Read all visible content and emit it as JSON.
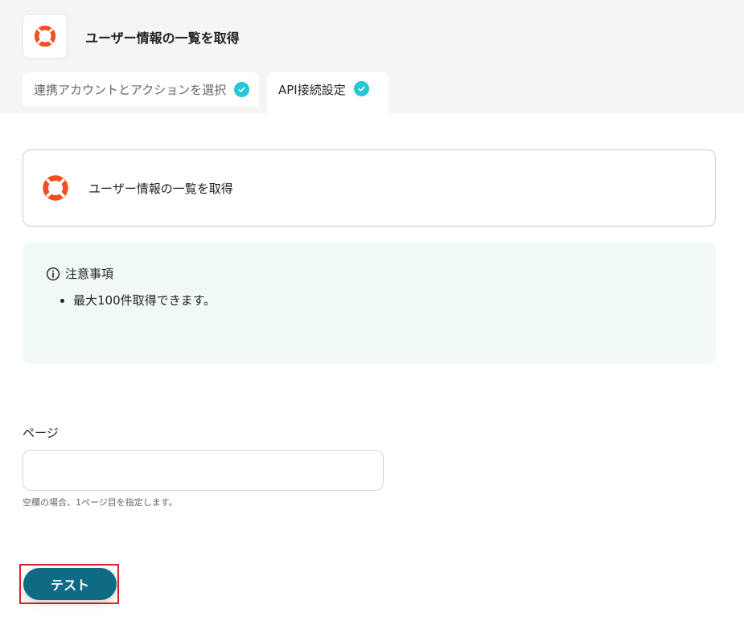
{
  "header": {
    "app_icon": "lifebuoy-icon",
    "title": "ユーザー情報の一覧を取得"
  },
  "tabs": [
    {
      "label": "連携アカウントとアクションを選択",
      "status_icon": "check-circle-icon",
      "completed": true,
      "active": false
    },
    {
      "label": "API接続設定",
      "status_icon": "check-circle-icon",
      "completed": true,
      "active": true
    }
  ],
  "action_card": {
    "icon": "lifebuoy-icon",
    "title": "ユーザー情報の一覧を取得"
  },
  "notice": {
    "icon": "info-icon",
    "heading": "注意事項",
    "items": [
      "最大100件取得できます。"
    ]
  },
  "page_field": {
    "label": "ページ",
    "value": "",
    "placeholder": "",
    "help": "空欄の場合、1ページ目を指定します。"
  },
  "actions": {
    "test_label": "テスト"
  },
  "colors": {
    "accent_check": "#27c5d6",
    "button": "#0f6b84",
    "highlight": "#d9242a",
    "notice_bg": "#f1f9f8",
    "icon_orange": "#f04e23"
  }
}
